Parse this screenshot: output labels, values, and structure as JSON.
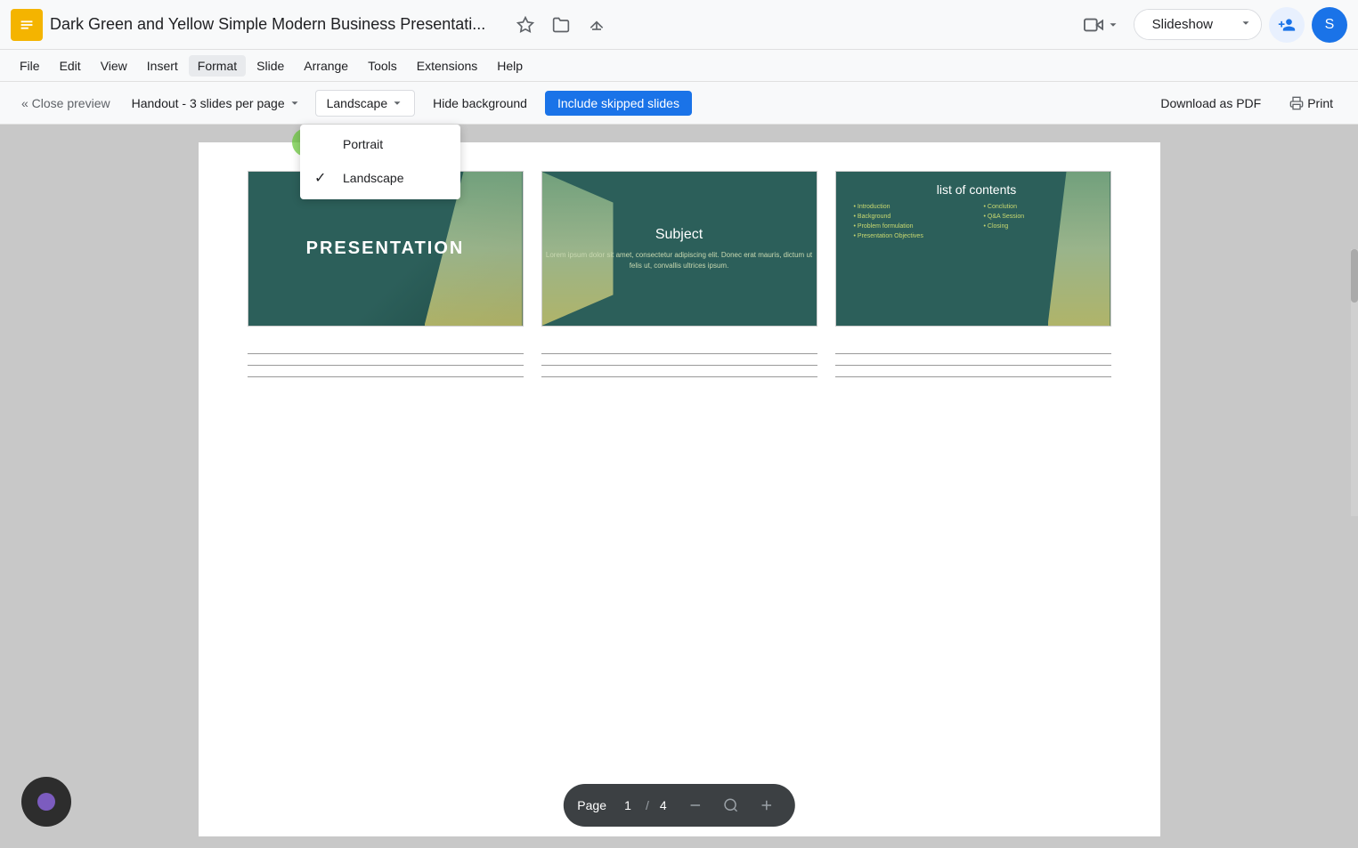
{
  "app": {
    "icon_text": "S",
    "title": "Dark Green and Yellow Simple Modern Business Presentati...",
    "menu_items": [
      "File",
      "Edit",
      "View",
      "Insert",
      "Format",
      "Slide",
      "Arrange",
      "Tools",
      "Extensions",
      "Help"
    ]
  },
  "toolbar_right": {
    "video_label": "▶",
    "slideshow_label": "Slideshow",
    "add_user_icon": "person_add",
    "avatar_label": "S"
  },
  "preview_bar": {
    "close_preview_label": "« Close preview",
    "handout_label": "Handout - 3 slides per page",
    "orientation_label": "Landscape",
    "hide_background_label": "Hide background",
    "include_skipped_label": "Include skipped slides",
    "download_pdf_label": "Download as PDF",
    "print_label": "Print"
  },
  "orientation_dropdown": {
    "items": [
      {
        "label": "Portrait",
        "checked": false
      },
      {
        "label": "Landscape",
        "checked": true
      }
    ]
  },
  "slides": [
    {
      "type": "title",
      "title": "PRESENTATION"
    },
    {
      "type": "subject",
      "title": "Subject",
      "body": "Lorem ipsum dolor sit amet,\nconsectetur adipiscing elit. Donec erat\nmauris, dictum ut felis ut, convallis\nultrices ipsum."
    },
    {
      "type": "contents",
      "title": "list of contents",
      "col1": [
        "• Introduction",
        "• Background",
        "• Problem formulation",
        "• Presentation Objectives"
      ],
      "col2": [
        "• Conclution",
        "• Q&A Session",
        "• Closing"
      ]
    }
  ],
  "page_nav": {
    "label": "Page",
    "current": "1",
    "separator": "/",
    "total": "4"
  },
  "colors": {
    "slide_bg": "#2c5f5a",
    "accent": "#1a73e8",
    "include_btn_bg": "#1a73e8",
    "include_btn_text": "#ffffff"
  }
}
